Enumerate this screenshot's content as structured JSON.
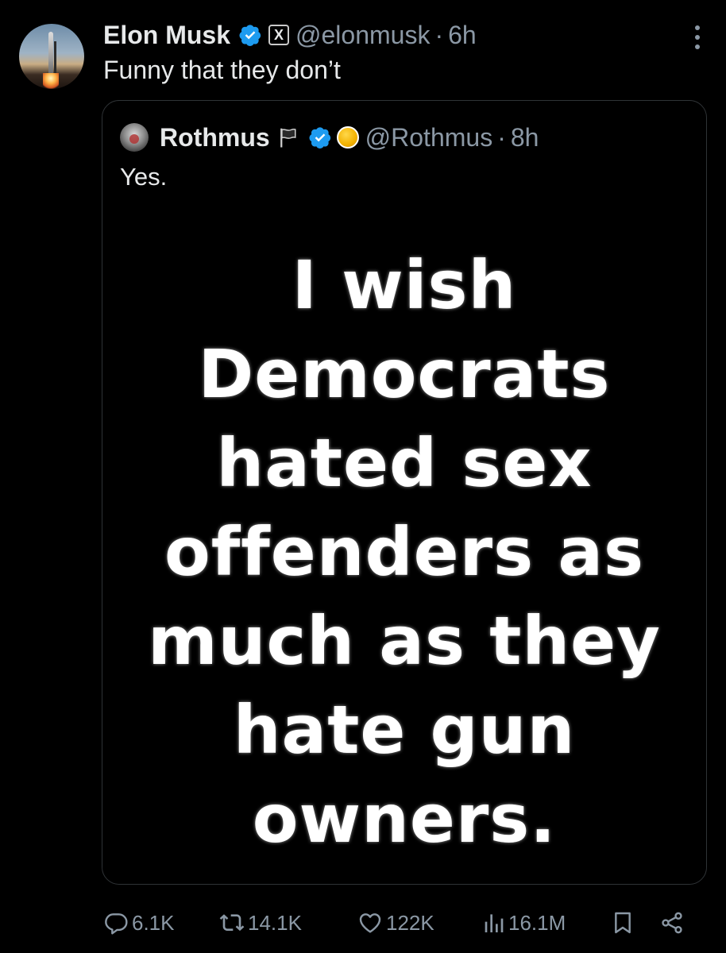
{
  "post": {
    "author": {
      "name": "Elon Musk",
      "handle": "@elonmusk",
      "separator": "·",
      "time": "6h",
      "affiliate_badge": "X"
    },
    "text": "Funny that they don’t"
  },
  "quoted_post": {
    "author": {
      "name": "Rothmus",
      "handle": "@Rothmus",
      "separator": "·",
      "time": "8h"
    },
    "text": "Yes.",
    "image_lines": [
      "I wish",
      "Democrats",
      "hated sex",
      "offenders as",
      "much as they",
      "hate gun",
      "owners."
    ]
  },
  "actions": {
    "replies": "6.1K",
    "reposts": "14.1K",
    "likes": "122K",
    "views": "16.1M"
  },
  "icons": {
    "verified": "verified-badge-icon",
    "more": "more-options-icon",
    "flag": "flag-icon",
    "reply": "reply-icon",
    "repost": "repost-icon",
    "like": "heart-icon",
    "views": "views-chart-icon",
    "bookmark": "bookmark-icon",
    "share": "share-icon"
  },
  "colors": {
    "background": "#000000",
    "text_primary": "#e7e9ea",
    "text_secondary": "#8b98a5",
    "verified_blue": "#1d9bf0",
    "border": "#2f3336"
  }
}
